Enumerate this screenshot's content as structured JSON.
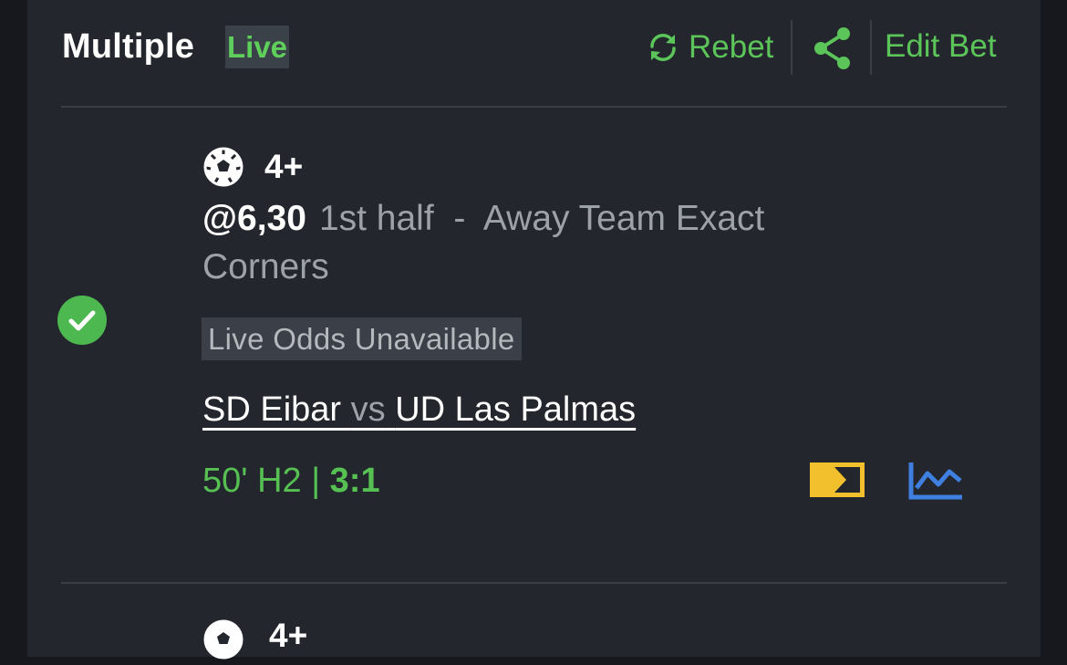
{
  "header": {
    "title": "Multiple",
    "live_badge": "Live",
    "rebet_label": "Rebet",
    "edit_bet_label": "Edit Bet"
  },
  "selection": {
    "status": "won",
    "label": "4+",
    "odds": "@6,30",
    "market": "1st half  -  Away Team Exact Corners",
    "live_odds_notice": "Live Odds Unavailable",
    "home_team": "SD Eibar",
    "vs": "vs",
    "away_team": "UD Las Palmas",
    "match_time": "50' H2 | ",
    "score": "3:1"
  },
  "next_selection": {
    "label": "4+"
  },
  "icons": {
    "rebet": "refresh-icon",
    "share": "share-icon",
    "status": "check-circle-icon",
    "sport": "soccer-ball-icon",
    "tv": "live-stream-icon",
    "stats": "stats-chart-icon"
  },
  "colors": {
    "background": "#16181d",
    "card": "#23262d",
    "accent_green": "#5cc55a",
    "tv_yellow": "#f2c02c",
    "stats_blue": "#3f7fe0"
  }
}
